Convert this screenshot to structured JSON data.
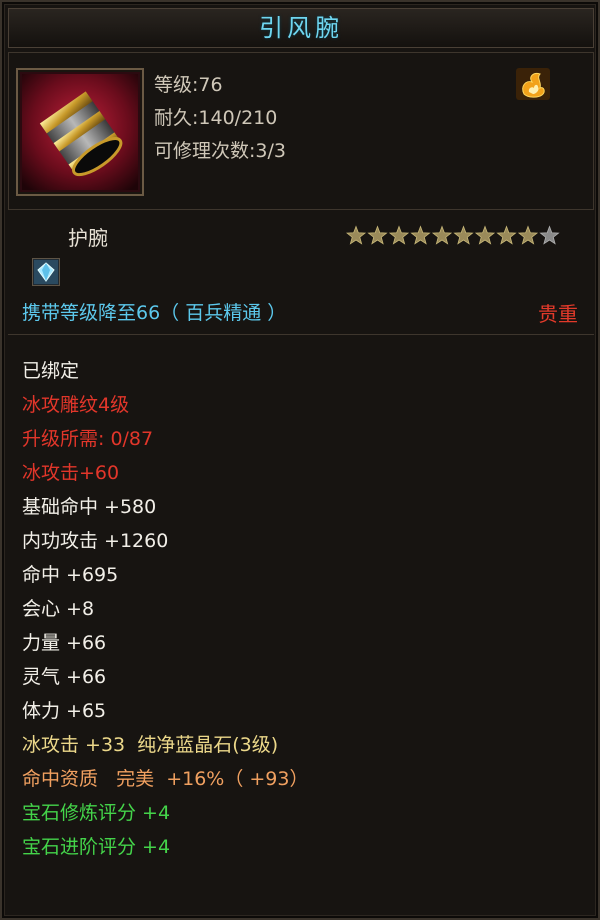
{
  "title": "引风腕",
  "header": {
    "level": "等级:76",
    "durability": "耐久:140/210",
    "repair": "可修理次数:3/3"
  },
  "item": {
    "type": "护腕",
    "stars_filled": 9,
    "stars_total": 10,
    "carry": "携带等级降至66（ 百兵精通 ）",
    "quality": "贵重"
  },
  "attributes": {
    "bound": "已绑定",
    "engrave": "冰攻雕纹4级",
    "upgrade": "升级所需: 0/87",
    "ice_atk": "冰攻击+60",
    "base_hit": "基础命中 +580",
    "inner_atk": "内功攻击 +1260",
    "hit": "命中 +695",
    "crit": "会心 +8",
    "str": "力量 +66",
    "spirit": "灵气 +66",
    "stamina": "体力 +65",
    "gem_line": "冰攻击 +33  纯净蓝晶石(3级)",
    "aptitude": "命中资质   完美  +16%（ +93）",
    "gem_refine": "宝石修炼评分 +4",
    "gem_advance": "宝石进阶评分 +4"
  },
  "colors": {
    "title": "#6fd6f0",
    "carry": "#5cc8ec",
    "quality": "#e23a2a",
    "red_attr": "#e2362a",
    "orange_attr": "#f0a060",
    "green_attr": "#44d44a"
  },
  "icons": {
    "item": "bracer-icon",
    "element": "flame-icon",
    "gem": "gem-slot-icon",
    "star": "star-icon"
  }
}
